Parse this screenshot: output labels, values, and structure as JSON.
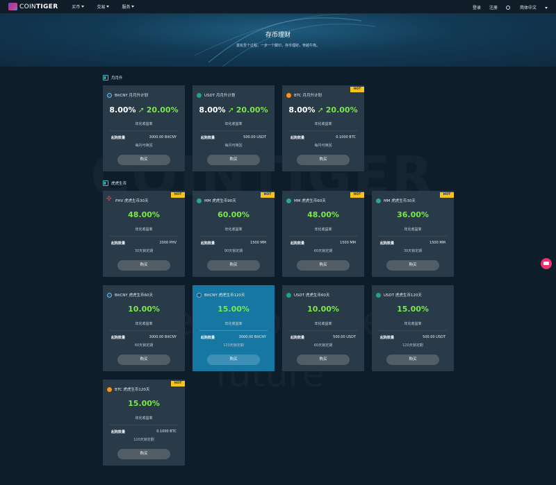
{
  "header": {
    "logo": {
      "text_light": "COIN",
      "text_bold": "TIGER"
    },
    "nav": [
      "买币",
      "交易",
      "服务"
    ],
    "login": "登录",
    "register": "注册",
    "language": "简体中文"
  },
  "hero": {
    "title": "存币理财",
    "subtitle": "富有圣个过程，一步一个脚印，存币理财，穿越牛熊。"
  },
  "watermark": {
    "line1": "COINTIGER",
    "line2": "Invest for The",
    "line3": "future"
  },
  "sections": [
    {
      "title": "月月升"
    },
    {
      "title": "虎虎生币"
    }
  ],
  "common": {
    "annual_rate_label": "年化收益率",
    "min_label": "起购数量",
    "buy_label": "购买",
    "hot_label": "HOT"
  },
  "monthly": [
    {
      "coin": "bitcny",
      "name": "BitCNY 月月升计划",
      "from": "8.00%",
      "to": "20.00%",
      "min": "3000.00 BitCNY",
      "term": "每月可赎回",
      "hot": false
    },
    {
      "coin": "usdt",
      "name": "USDT 月月升计划",
      "from": "8.00%",
      "to": "20.00%",
      "min": "500.00 USDT",
      "term": "每月可赎回",
      "hot": false
    },
    {
      "coin": "btc",
      "name": "BTC 月月升计划",
      "from": "8.00%",
      "to": "20.00%",
      "min": "0.1000 BTC",
      "term": "每月可赎回",
      "hot": true
    }
  ],
  "tiger": [
    {
      "coin": "phv",
      "name": "PHV 虎虎生币30天",
      "rate": "48.00%",
      "min": "2000 PHV",
      "term": "30天锁定期",
      "hot": true
    },
    {
      "coin": "mm",
      "name": "MM 虎虎生币90天",
      "rate": "60.00%",
      "min": "1500 MM",
      "term": "90天锁定期",
      "hot": true
    },
    {
      "coin": "mm",
      "name": "MM 虎虎生币60天",
      "rate": "48.00%",
      "min": "1500 MM",
      "term": "60天锁定期",
      "hot": true
    },
    {
      "coin": "mm",
      "name": "MM 虎虎生币30天",
      "rate": "36.00%",
      "min": "1500 MM",
      "term": "30天锁定期",
      "hot": true
    },
    {
      "coin": "bitcny",
      "name": "BitCNY 虎虎生币60天",
      "rate": "10.00%",
      "min": "3000.00 BitCNY",
      "term": "60天锁定期",
      "hot": false
    },
    {
      "coin": "bitcny",
      "name": "BitCNY 虎虎生币120天",
      "rate": "15.00%",
      "min": "3000.00 BitCNY",
      "term": "120天锁定期",
      "hot": false,
      "active": true
    },
    {
      "coin": "usdt",
      "name": "USDT 虎虎生币60天",
      "rate": "10.00%",
      "min": "500.00 USDT",
      "term": "60天锁定期",
      "hot": false
    },
    {
      "coin": "usdt",
      "name": "USDT 虎虎生币120天",
      "rate": "15.00%",
      "min": "500.00 USDT",
      "term": "120天锁定期",
      "hot": false
    },
    {
      "coin": "btc",
      "name": "BTC 虎虎生币120天",
      "rate": "15.00%",
      "min": "0.1000 BTC",
      "term": "120天锁定期",
      "hot": true
    }
  ],
  "colors": {
    "accent_green": "#7be84a",
    "hot_badge": "#f7c51a",
    "active_card": "#1677a2",
    "card_bg": "#293a48",
    "chat_fab": "#e8336f"
  }
}
